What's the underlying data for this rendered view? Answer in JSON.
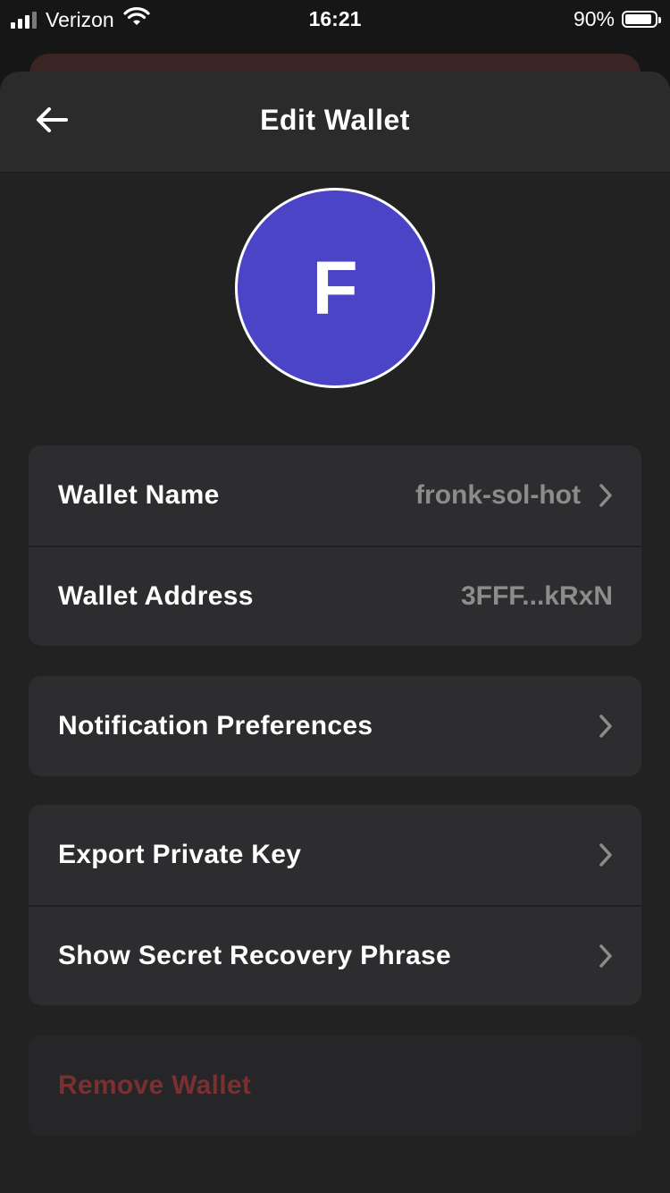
{
  "status_bar": {
    "carrier": "Verizon",
    "time": "16:21",
    "battery_percent": "90%",
    "battery_level": 0.9,
    "signal_bars_active": 3,
    "signal_bars_total": 4
  },
  "header": {
    "title": "Edit Wallet",
    "back_icon": "arrow-left-icon"
  },
  "avatar": {
    "initial": "F",
    "color": "#4b44c6"
  },
  "wallet_info": {
    "name_label": "Wallet Name",
    "name_value": "fronk-sol-hot",
    "address_label": "Wallet Address",
    "address_value": "3FFF...kRxN"
  },
  "notifications": {
    "label": "Notification Preferences"
  },
  "security": {
    "export_label": "Export Private Key",
    "recovery_label": "Show Secret Recovery Phrase"
  },
  "danger": {
    "remove_label": "Remove Wallet",
    "color": "#7a2f31"
  },
  "colors": {
    "background": "#222222",
    "card": "#2d2d30",
    "secondary_text": "#8c8c8c"
  }
}
